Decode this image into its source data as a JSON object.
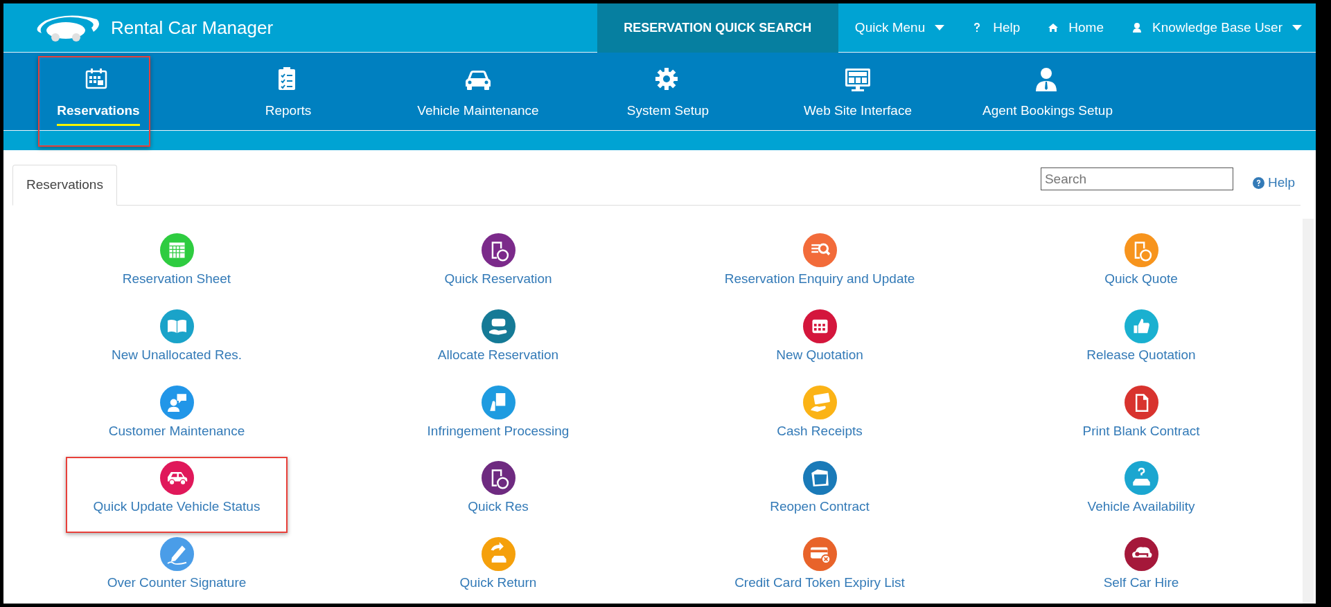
{
  "app": {
    "title": "Rental Car Manager"
  },
  "top_nav": {
    "quick_search": "RESERVATION QUICK SEARCH",
    "items": [
      {
        "label": "Quick Menu",
        "dropdown": true
      },
      {
        "label": "Help",
        "dropdown": false
      },
      {
        "label": "Home",
        "dropdown": false
      },
      {
        "label": "Knowledge Base User",
        "dropdown": true
      }
    ]
  },
  "modules": [
    {
      "label": "Reservations",
      "selected": true,
      "highlighted": true
    },
    {
      "label": "Reports",
      "selected": false,
      "highlighted": false
    },
    {
      "label": "Vehicle Maintenance",
      "selected": false,
      "highlighted": false
    },
    {
      "label": "System Setup",
      "selected": false,
      "highlighted": false
    },
    {
      "label": "Web Site Interface",
      "selected": false,
      "highlighted": false
    },
    {
      "label": "Agent Bookings Setup",
      "selected": false,
      "highlighted": false
    }
  ],
  "tabs": [
    {
      "label": "Reservations",
      "selected": true
    }
  ],
  "search": {
    "placeholder": "Search"
  },
  "help": "Help",
  "tiles": [
    {
      "label": "Reservation Sheet",
      "color": "#2ecc40",
      "highlighted": false
    },
    {
      "label": "Quick Reservation",
      "color": "#7b2a8a",
      "highlighted": false
    },
    {
      "label": "Reservation Enquiry and Update",
      "color": "#f26b3a",
      "highlighted": false
    },
    {
      "label": "Quick Quote",
      "color": "#f7941d",
      "highlighted": false
    },
    {
      "label": "New Unallocated Res.",
      "color": "#1aa3c9",
      "highlighted": false
    },
    {
      "label": "Allocate Reservation",
      "color": "#157a96",
      "highlighted": false
    },
    {
      "label": "New Quotation",
      "color": "#d4163c",
      "highlighted": false
    },
    {
      "label": "Release Quotation",
      "color": "#1ab0d0",
      "highlighted": false
    },
    {
      "label": "Customer Maintenance",
      "color": "#2196e8",
      "highlighted": false
    },
    {
      "label": "Infringement Processing",
      "color": "#1e9be0",
      "highlighted": false
    },
    {
      "label": "Cash Receipts",
      "color": "#fbb316",
      "highlighted": false
    },
    {
      "label": "Print Blank Contract",
      "color": "#d8332e",
      "highlighted": false
    },
    {
      "label": "Quick Update Vehicle Status",
      "color": "#e0185a",
      "highlighted": true
    },
    {
      "label": "Quick Res",
      "color": "#6e2a80",
      "highlighted": false
    },
    {
      "label": "Reopen Contract",
      "color": "#1a7ab8",
      "highlighted": false
    },
    {
      "label": "Vehicle Availability",
      "color": "#1ba6d0",
      "highlighted": false
    },
    {
      "label": "Over Counter Signature",
      "color": "#4a9de8",
      "highlighted": false
    },
    {
      "label": "Quick Return",
      "color": "#f5a00b",
      "highlighted": false
    },
    {
      "label": "Credit Card Token Expiry List",
      "color": "#e8632a",
      "highlighted": false
    },
    {
      "label": "Self Car Hire",
      "color": "#a5183a",
      "highlighted": false
    }
  ]
}
